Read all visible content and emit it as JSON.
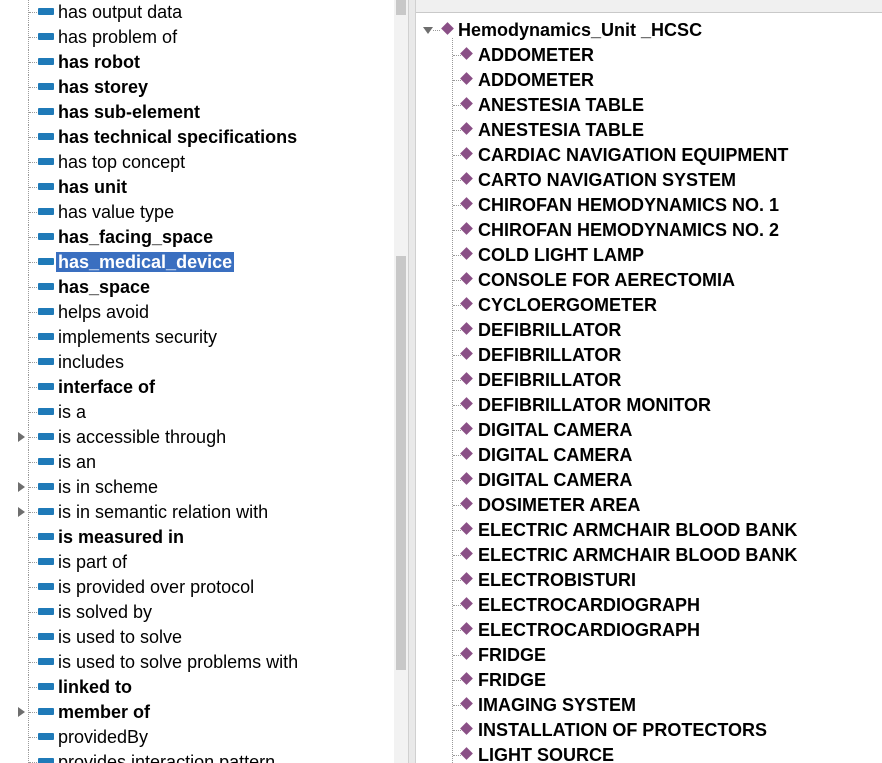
{
  "property_tree": {
    "items": [
      {
        "label": "has output data",
        "bold": false,
        "expandable": false,
        "selected": false
      },
      {
        "label": "has problem of",
        "bold": false,
        "expandable": false,
        "selected": false
      },
      {
        "label": "has robot",
        "bold": true,
        "expandable": false,
        "selected": false
      },
      {
        "label": "has storey",
        "bold": true,
        "expandable": false,
        "selected": false
      },
      {
        "label": "has sub-element",
        "bold": true,
        "expandable": false,
        "selected": false
      },
      {
        "label": "has technical specifications",
        "bold": true,
        "expandable": false,
        "selected": false
      },
      {
        "label": "has top concept",
        "bold": false,
        "expandable": false,
        "selected": false
      },
      {
        "label": "has unit",
        "bold": true,
        "expandable": false,
        "selected": false
      },
      {
        "label": "has value type",
        "bold": false,
        "expandable": false,
        "selected": false
      },
      {
        "label": "has_facing_space",
        "bold": true,
        "expandable": false,
        "selected": false
      },
      {
        "label": "has_medical_device",
        "bold": true,
        "expandable": false,
        "selected": true
      },
      {
        "label": "has_space",
        "bold": true,
        "expandable": false,
        "selected": false
      },
      {
        "label": "helps avoid",
        "bold": false,
        "expandable": false,
        "selected": false
      },
      {
        "label": "implements security",
        "bold": false,
        "expandable": false,
        "selected": false
      },
      {
        "label": "includes",
        "bold": false,
        "expandable": false,
        "selected": false
      },
      {
        "label": "interface of",
        "bold": true,
        "expandable": false,
        "selected": false
      },
      {
        "label": "is a",
        "bold": false,
        "expandable": false,
        "selected": false
      },
      {
        "label": "is accessible through",
        "bold": false,
        "expandable": true,
        "selected": false
      },
      {
        "label": "is an",
        "bold": false,
        "expandable": false,
        "selected": false
      },
      {
        "label": "is in scheme",
        "bold": false,
        "expandable": true,
        "selected": false
      },
      {
        "label": "is in semantic relation with",
        "bold": false,
        "expandable": true,
        "selected": false
      },
      {
        "label": "is measured in",
        "bold": true,
        "expandable": false,
        "selected": false
      },
      {
        "label": "is part of",
        "bold": false,
        "expandable": false,
        "selected": false
      },
      {
        "label": "is provided over protocol",
        "bold": false,
        "expandable": false,
        "selected": false
      },
      {
        "label": "is solved by",
        "bold": false,
        "expandable": false,
        "selected": false
      },
      {
        "label": "is used to solve",
        "bold": false,
        "expandable": false,
        "selected": false
      },
      {
        "label": "is used to solve problems with",
        "bold": false,
        "expandable": false,
        "selected": false
      },
      {
        "label": "linked to",
        "bold": true,
        "expandable": false,
        "selected": false
      },
      {
        "label": "member of",
        "bold": true,
        "expandable": true,
        "selected": false
      },
      {
        "label": "providedBy",
        "bold": false,
        "expandable": false,
        "selected": false
      },
      {
        "label": "provides interaction pattern",
        "bold": false,
        "expandable": false,
        "selected": false
      }
    ]
  },
  "individual_tree": {
    "root_label": "Hemodynamics_Unit _HCSC",
    "items": [
      "ADDOMETER",
      "ADDOMETER",
      "ANESTESIA TABLE",
      "ANESTESIA TABLE",
      "CARDIAC NAVIGATION EQUIPMENT",
      "CARTO NAVIGATION SYSTEM",
      "CHIROFAN HEMODYNAMICS NO. 1",
      "CHIROFAN HEMODYNAMICS NO. 2",
      "COLD LIGHT LAMP",
      "CONSOLE FOR AERECTOMIA",
      "CYCLOERGOMETER",
      "DEFIBRILLATOR",
      "DEFIBRILLATOR",
      "DEFIBRILLATOR",
      "DEFIBRILLATOR MONITOR",
      "DIGITAL CAMERA",
      "DIGITAL CAMERA",
      "DIGITAL CAMERA",
      "DOSIMETER AREA",
      "ELECTRIC ARMCHAIR BLOOD BANK",
      "ELECTRIC ARMCHAIR BLOOD BANK",
      "ELECTROBISTURI",
      "ELECTROCARDIOGRAPH",
      "ELECTROCARDIOGRAPH",
      "FRIDGE",
      "FRIDGE",
      "IMAGING SYSTEM",
      "INSTALLATION OF PROTECTORS",
      "LIGHT SOURCE"
    ]
  },
  "colors": {
    "property_icon": "#1f7ab8",
    "individual_icon": "#8a4f86",
    "selection": "#3a6fc0"
  },
  "icons": {
    "property": "object-property-icon",
    "individual": "individual-diamond-icon",
    "expand_collapsed": "triangle-right-icon",
    "expand_open": "triangle-down-icon"
  }
}
